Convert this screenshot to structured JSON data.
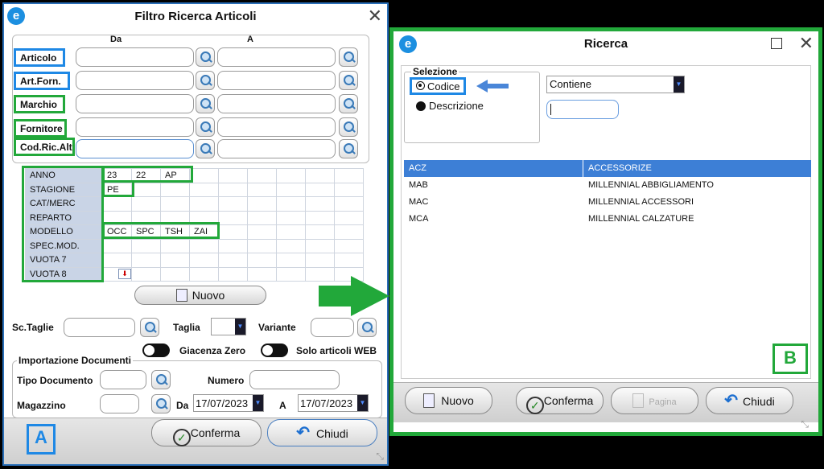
{
  "arrow_color": "#22a83a",
  "filter": {
    "title": "Filtro Ricerca Articoli",
    "col_da": "Da",
    "col_a": "A",
    "rows": [
      "Articolo",
      "Art.Forn.",
      "Marchio",
      "Fornitore",
      "Cod.Ric.Alt"
    ],
    "grid": [
      {
        "label": "ANNO",
        "values": [
          "23",
          "22",
          "AP",
          "",
          "",
          "",
          "",
          "",
          ""
        ]
      },
      {
        "label": "STAGIONE",
        "values": [
          "PE",
          "",
          "",
          "",
          "",
          "",
          "",
          "",
          ""
        ]
      },
      {
        "label": "CAT/MERC",
        "values": [
          "",
          "",
          "",
          "",
          "",
          "",
          "",
          "",
          ""
        ]
      },
      {
        "label": "REPARTO",
        "values": [
          "",
          "",
          "",
          "",
          "",
          "",
          "",
          "",
          ""
        ]
      },
      {
        "label": "MODELLO",
        "values": [
          "OCC",
          "SPC",
          "TSH",
          "ZAI",
          "",
          "",
          "",
          "",
          ""
        ]
      },
      {
        "label": "SPEC.MOD.",
        "values": [
          "",
          "",
          "",
          "",
          "",
          "",
          "",
          "",
          ""
        ]
      },
      {
        "label": "VUOTA 7",
        "values": [
          "",
          "",
          "",
          "",
          "",
          "",
          "",
          "",
          ""
        ]
      },
      {
        "label": "VUOTA 8",
        "values": [
          "",
          "",
          "",
          "",
          "",
          "",
          "",
          "",
          ""
        ]
      }
    ],
    "nuovo": "Nuovo",
    "sc_taglie": "Sc.Taglie",
    "taglia": "Taglia",
    "variante": "Variante",
    "giacenza_zero": "Giacenza Zero",
    "solo_web": "Solo articoli WEB",
    "importazione": "Importazione Documenti",
    "tipo_documento": "Tipo Documento",
    "numero": "Numero",
    "magazzino": "Magazzino",
    "da": "Da",
    "a": "A",
    "date_da": "17/07/2023",
    "date_a": "17/07/2023",
    "conferma": "Conferma",
    "chiudi": "Chiudi",
    "badge": "A"
  },
  "ricerca": {
    "title": "Ricerca",
    "selezione": "Selezione",
    "opt_codice": "Codice",
    "opt_descrizione": "Descrizione",
    "match": "Contiene",
    "list": [
      {
        "code": "ACZ",
        "desc": "ACCESSORIZE"
      },
      {
        "code": "MAB",
        "desc": "MILLENNIAL ABBIGLIAMENTO"
      },
      {
        "code": "MAC",
        "desc": "MILLENNIAL ACCESSORI"
      },
      {
        "code": "MCA",
        "desc": "MILLENNIAL CALZATURE"
      }
    ],
    "nuovo": "Nuovo",
    "conferma": "Conferma",
    "pagina": "Pagina",
    "chiudi": "Chiudi",
    "badge": "B"
  }
}
